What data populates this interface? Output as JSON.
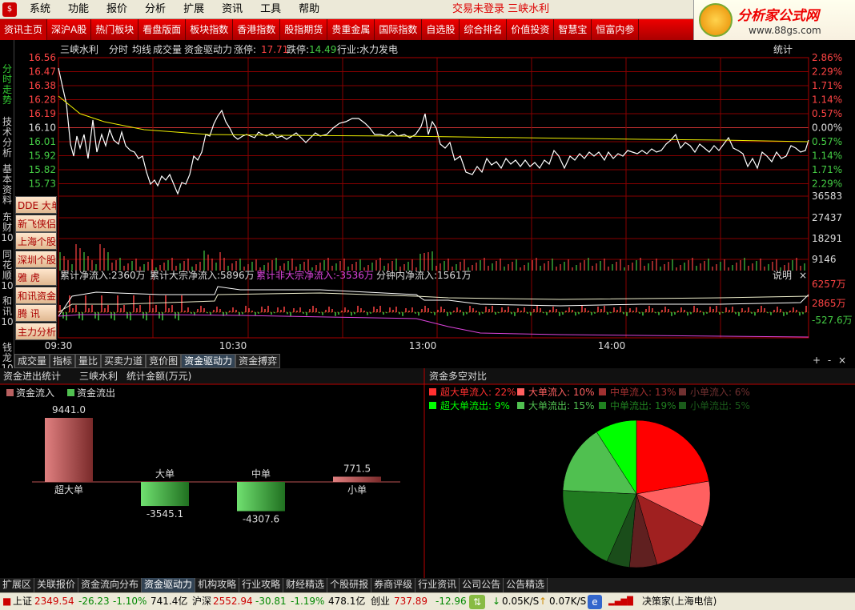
{
  "menubar": {
    "items": [
      "系统",
      "功能",
      "报价",
      "分析",
      "扩展",
      "资讯",
      "工具",
      "帮助"
    ],
    "status": "交易未登录 三峡水利"
  },
  "logo": {
    "title": "分析家公式网",
    "url": "www.88gs.com"
  },
  "navbar": {
    "items": [
      "资讯主页",
      "深沪A股",
      "热门板块",
      "看盘版面",
      "板块指数",
      "香港指数",
      "股指期货",
      "贵重金属",
      "国际指数",
      "自选股",
      "综合排名",
      "价值投资",
      "智慧宝",
      "恒富内参"
    ],
    "active": 0
  },
  "leftbar": {
    "tabs": [
      "分时走势",
      "技术分析",
      "基本资料",
      "东财10",
      "同花顺10",
      "和讯10",
      "钱龙10"
    ]
  },
  "sidebuttons": [
    "DDE 大单",
    "新飞侠侣",
    "上海个股",
    "深圳个股",
    "雅 虎",
    "和讯资金",
    "腾 讯",
    "主力分析"
  ],
  "chart_header": {
    "stock": "三峡水利",
    "mode1": "分时",
    "mode2": "均线",
    "mode3": "成交量",
    "mode4": "资金驱动力",
    "zt_label": "涨停:",
    "zt": "17.71",
    "dt_label": "跌停:",
    "dt": "14.49",
    "industry": "行业:水力发电",
    "right": "统计"
  },
  "price_axis": {
    "left": [
      "16.56",
      "16.47",
      "16.38",
      "16.28",
      "16.19",
      "16.10",
      "16.01",
      "15.92",
      "15.82",
      "15.73"
    ],
    "right": [
      "2.86%",
      "2.29%",
      "1.71%",
      "1.14%",
      "0.57%",
      "0.00%",
      "0.57%",
      "1.14%",
      "1.71%",
      "2.29%"
    ]
  },
  "volume_axis": [
    "36583",
    "27437",
    "18291",
    "9146"
  ],
  "flow_header": {
    "a": "累计净流入:2360万",
    "b": "累计大宗净流入:5896万",
    "c": "累计非大宗净流入:-3536万",
    "d": "分钟内净流入:1561万",
    "help": "说明",
    "close": "×"
  },
  "flow_axis": [
    "6257万",
    "2865万",
    "-527.6万"
  ],
  "time_axis": [
    "09:30",
    "10:30",
    "13:00",
    "14:00"
  ],
  "tabs1": {
    "items": [
      "成交量",
      "指标",
      "量比",
      "买卖力道",
      "竞价图",
      "资金驱动力",
      "资金搏弈"
    ],
    "active": 5,
    "controls": [
      "+",
      "-",
      "×"
    ]
  },
  "left_panel": {
    "title": "资金进出统计",
    "stock": "三峡水利",
    "unit": "统计金额(万元)",
    "legend_in": "资金流入",
    "legend_out": "资金流出"
  },
  "chart_data": [
    {
      "type": "bar",
      "categories": [
        "超大单",
        "大单",
        "中单",
        "小单"
      ],
      "values": [
        9441.0,
        -3545.1,
        -4307.6,
        771.5
      ],
      "colors": [
        "#b86060",
        "#50c050",
        "#40b040",
        "#b86060"
      ],
      "value_labels": [
        "9441.0",
        "-3545.1",
        "-4307.6",
        "771.5"
      ]
    },
    {
      "type": "pie",
      "title": "资金多空对比",
      "slices": [
        {
          "name": "超大单流入",
          "value": 22,
          "color": "#ff0000"
        },
        {
          "name": "大单流入",
          "value": 10,
          "color": "#ff6060"
        },
        {
          "name": "中单流入",
          "value": 13,
          "color": "#a02020"
        },
        {
          "name": "小单流入",
          "value": 6,
          "color": "#602020"
        },
        {
          "name": "小单流出",
          "value": 5,
          "color": "#1a4d1a"
        },
        {
          "name": "中单流出",
          "value": 19,
          "color": "#207a20"
        },
        {
          "name": "大单流出",
          "value": 15,
          "color": "#50c050"
        },
        {
          "name": "超大单流出",
          "value": 9,
          "color": "#00ff00"
        }
      ],
      "legend_row1": [
        "超大单流入: 22%",
        "大单流入: 10%",
        "中单流入: 13%",
        "小单流入: 6%"
      ],
      "legend_row2": [
        "超大单流出: 9%",
        "大单流出: 15%",
        "中单流出: 19%",
        "小单流出: 5%"
      ]
    }
  ],
  "tabs2": {
    "items": [
      "扩展区",
      "关联报价",
      "资金流向分布",
      "资金驱动力",
      "机构攻略",
      "行业攻略",
      "财经精选",
      "个股研报",
      "券商评级",
      "行业资讯",
      "公司公告",
      "公告精选"
    ],
    "active": 3
  },
  "statusbar": {
    "sh_label": "上证",
    "sh": "2349.54",
    "sh_chg": "-26.23",
    "sh_pct": "-1.10%",
    "sh_amt": "741.4亿",
    "sz_label": "沪深",
    "sz": "2552.94",
    "sz_chg": "-30.81",
    "sz_pct": "-1.19%",
    "sz_amt": "478.1亿",
    "cy_label": "创业",
    "cy": "737.89",
    "cy_chg": "-12.96",
    "down": "0.05K/S",
    "up": "0.07K/S",
    "app": "决策家(上海电信)"
  }
}
